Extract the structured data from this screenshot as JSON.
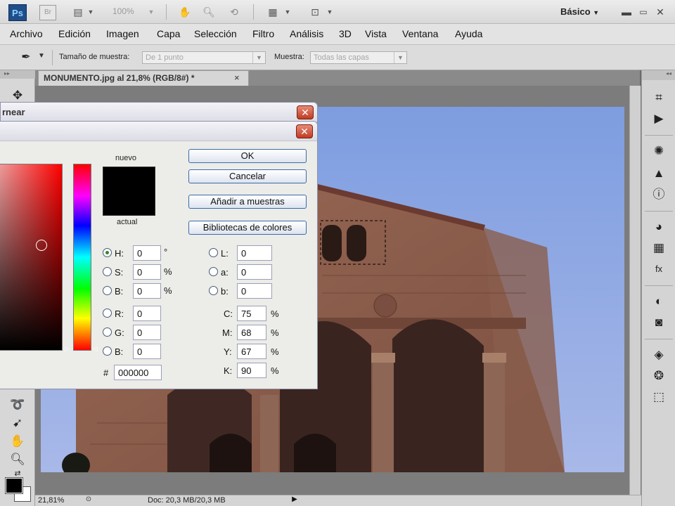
{
  "app": {
    "logo": "Ps",
    "bridge": "Br",
    "zoom_preset": "100%",
    "workspace": "Básico",
    "window_controls": [
      "minimize-icon",
      "restore-icon",
      "close-icon"
    ]
  },
  "menu": [
    "Archivo",
    "Edición",
    "Imagen",
    "Capa",
    "Selección",
    "Filtro",
    "Análisis",
    "3D",
    "Vista",
    "Ventana",
    "Ayuda"
  ],
  "options": {
    "tool_icon": "eyedropper-icon",
    "sample_size_label": "Tamaño de muestra:",
    "sample_size_value": "De 1 punto",
    "sample_label": "Muestra:",
    "sample_value": "Todas las capas"
  },
  "document": {
    "tab_title": "MONUMENTO.jpg al 21,8% (RGB/8#) *",
    "close": "×"
  },
  "back_dialog": {
    "title_fragment": "rnear"
  },
  "picker": {
    "new_label": "nuevo",
    "current_label": "actual",
    "new_color": "#000000",
    "current_color": "#000000",
    "buttons": {
      "ok": "OK",
      "cancel": "Cancelar",
      "add_swatch": "Añadir a muestras",
      "libraries": "Bibliotecas de colores"
    },
    "hsb": [
      {
        "label": "H:",
        "value": "0",
        "unit": "°",
        "selected": true
      },
      {
        "label": "S:",
        "value": "0",
        "unit": "%",
        "selected": false
      },
      {
        "label": "B:",
        "value": "0",
        "unit": "%",
        "selected": false
      }
    ],
    "rgb": [
      {
        "label": "R:",
        "value": "0"
      },
      {
        "label": "G:",
        "value": "0"
      },
      {
        "label": "B:",
        "value": "0"
      }
    ],
    "lab": [
      {
        "label": "L:",
        "value": "0"
      },
      {
        "label": "a:",
        "value": "0"
      },
      {
        "label": "b:",
        "value": "0"
      }
    ],
    "cmyk": [
      {
        "label": "C:",
        "value": "75",
        "unit": "%"
      },
      {
        "label": "M:",
        "value": "68",
        "unit": "%"
      },
      {
        "label": "Y:",
        "value": "67",
        "unit": "%"
      },
      {
        "label": "K:",
        "value": "90",
        "unit": "%"
      }
    ],
    "hex_label": "#",
    "hex_value": "000000"
  },
  "status": {
    "zoom": "21,81%",
    "doc_size": "Doc: 20,3 MB/20,3 MB"
  },
  "colors": {
    "foreground": "#000000",
    "background": "#ffffff",
    "sky": "#7d9de0",
    "stone": "#8a5a48"
  }
}
